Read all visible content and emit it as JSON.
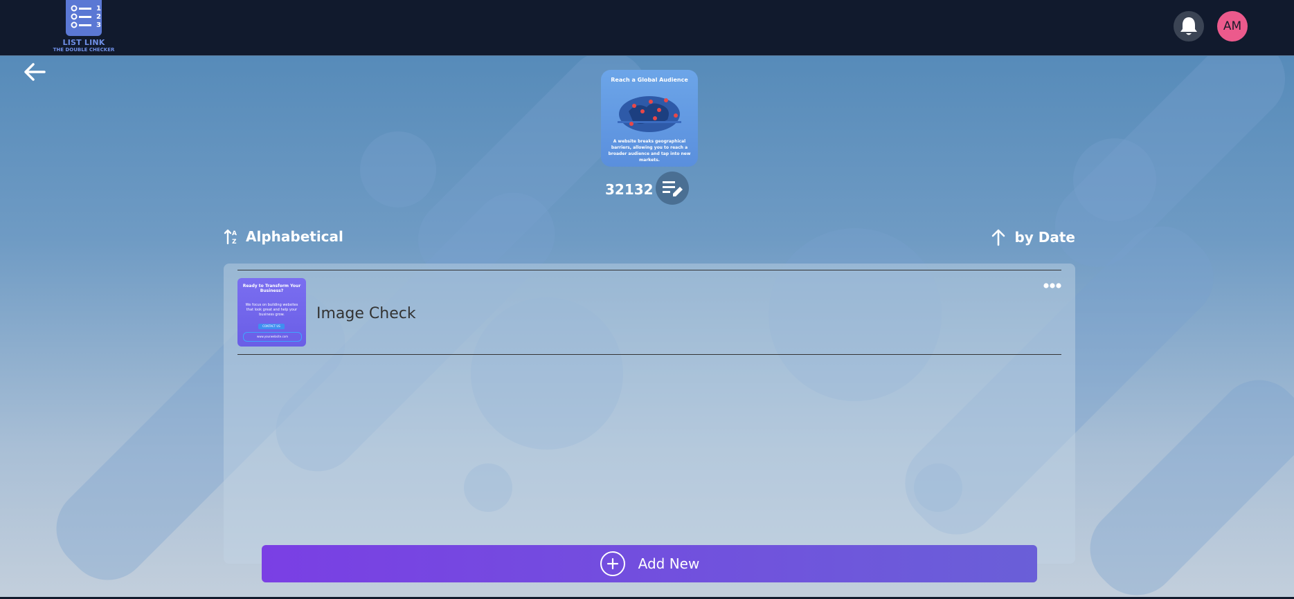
{
  "header": {
    "logo_title": "LIST LINK",
    "logo_subtitle": "THE DOUBLE CHECKER",
    "logo_list_numbers": [
      "1",
      "2",
      "3"
    ],
    "notification_icon": "bell-icon",
    "avatar_initials": "AM",
    "avatar_color": "#ec5a8c"
  },
  "nav": {
    "back_icon": "arrow-left-icon"
  },
  "list": {
    "cover_title": "Reach a Global Audience",
    "cover_text": "A website breaks geographical barriers, allowing you to reach a broader audience and tap into new markets.",
    "title": "32132",
    "edit_icon": "edit-list-icon"
  },
  "sort": {
    "alpha_icon": "sort-alpha-icon",
    "alpha_label": "Alphabetical",
    "date_icon": "arrow-up-icon",
    "date_label": "by Date"
  },
  "items": [
    {
      "name": "Image Check",
      "thumb_title": "Ready to Transform Your Business?",
      "thumb_text": "We focus on building websites that look great and help your business grow.",
      "thumb_button": "CONTACT US",
      "thumb_link": "www.yourwebsite.com",
      "menu_icon": "more-horizontal-icon"
    }
  ],
  "actions": {
    "add_new_label": "Add New",
    "add_icon": "plus-circle-icon",
    "accent_color": "#7a3fe4"
  }
}
